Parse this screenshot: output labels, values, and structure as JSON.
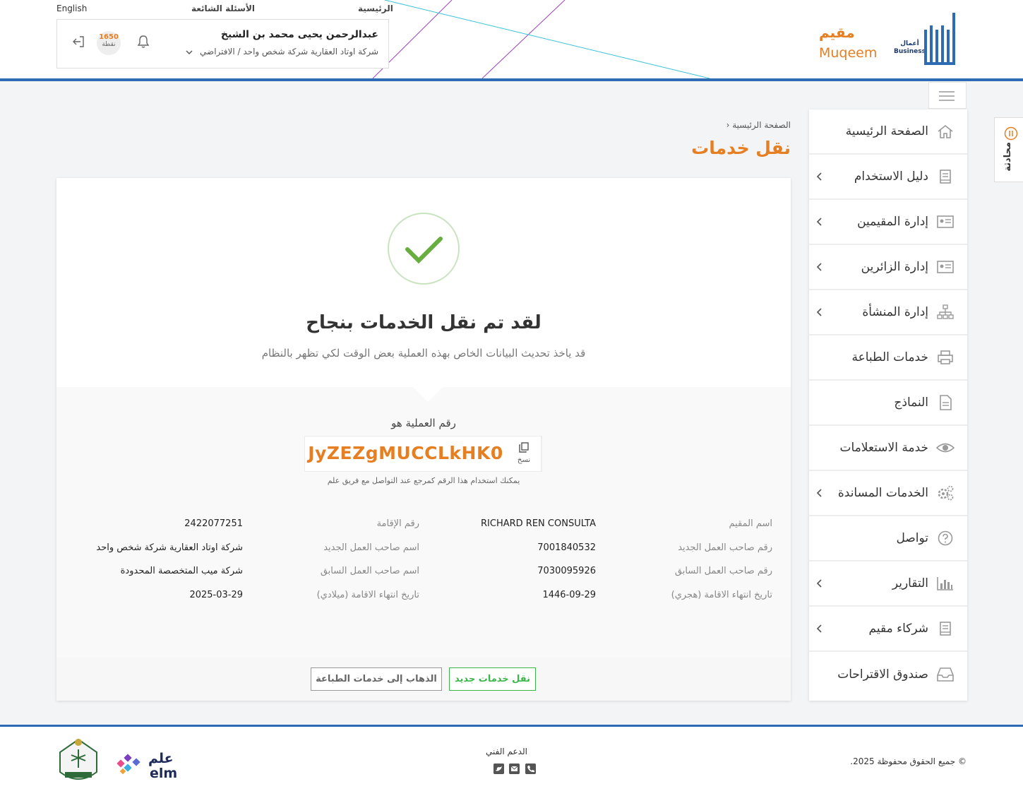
{
  "topnav": {
    "home": "الرئيسية",
    "faq": "الأسئلة الشائعة",
    "language": "English"
  },
  "user": {
    "name": "عبدالرحمن يحيى محمد بن الشيخ",
    "org": "شركة اوتاد العقارية شركة شخص واحد / الافتراضي",
    "points_value": "1650",
    "points_label": "نقطة"
  },
  "brand": {
    "muqeem_ar": "مقيم",
    "muqeem_en": "Muqeem",
    "absher_business_ar": "أعمال",
    "absher_business_en": "Business",
    "accent": "#e67e22",
    "primary": "#2d6cb5"
  },
  "sidebar": {
    "items": [
      {
        "label": "الصفحة الرئيسية",
        "icon": "home-icon",
        "chevron": false
      },
      {
        "label": "دليل الاستخدام",
        "icon": "book-icon",
        "chevron": true
      },
      {
        "label": "إدارة المقيمين",
        "icon": "id-card-icon",
        "chevron": true
      },
      {
        "label": "إدارة الزائرين",
        "icon": "id-card-icon",
        "chevron": true
      },
      {
        "label": "إدارة المنشأة",
        "icon": "org-chart-icon",
        "chevron": true
      },
      {
        "label": "خدمات الطباعة",
        "icon": "printer-icon",
        "chevron": false
      },
      {
        "label": "النماذج",
        "icon": "document-icon",
        "chevron": false
      },
      {
        "label": "خدمة الاستعلامات",
        "icon": "eye-icon",
        "chevron": false
      },
      {
        "label": "الخدمات المساندة",
        "icon": "gears-icon",
        "chevron": true
      },
      {
        "label": "تواصل",
        "icon": "help-icon",
        "chevron": false
      },
      {
        "label": "التقارير",
        "icon": "bar-chart-icon",
        "chevron": true
      },
      {
        "label": "شركاء مقيم",
        "icon": "book-icon",
        "chevron": true
      },
      {
        "label": "صندوق الاقتراحات",
        "icon": "inbox-icon",
        "chevron": false
      }
    ]
  },
  "chat": {
    "label": "محادثة"
  },
  "page": {
    "breadcrumb": "الصفحة الرئيسية",
    "title": "نقل خدمات"
  },
  "result": {
    "title": "لقد تم نقل الخدمات بنجاح",
    "subtitle": "قد ياخذ تحديث البيانات الخاص بهذه العملية بعض الوقت لكي تظهر بالنظام",
    "txn_label": "رقم العملية هو",
    "txn_code": "JyZEZgMUCCLkHK0",
    "copy_label": "نسخ",
    "txn_note": "يمكنك استخدام هذا الرقم كمرجع عند التواصل مع فريق علم"
  },
  "details": {
    "resident_name_label": "اسم المقيم",
    "resident_name": "RICHARD REN CONSULTA",
    "iqama_no_label": "رقم الإقامة",
    "iqama_no": "2422077251",
    "new_employer_no_label": "رقم صاحب العمل الجديد",
    "new_employer_no": "7001840532",
    "new_employer_name_label": "اسم صاحب العمل الجديد",
    "new_employer_name": "شركة اوتاد العقارية شركة شخص واحد",
    "prev_employer_no_label": "رقم صاحب العمل السابق",
    "prev_employer_no": "7030095926",
    "prev_employer_name_label": "اسم صاحب العمل السابق",
    "prev_employer_name": "شركة ميب المتخصصة المحدودة",
    "expiry_hijri_label": "تاريخ انتهاء الاقامة (هجري)",
    "expiry_hijri": "1446-09-29",
    "expiry_greg_label": "تاريخ انتهاء الاقامة (ميلادي)",
    "expiry_greg": "2025-03-29"
  },
  "actions": {
    "new_transfer": "نقل خدمات جديد",
    "go_print": "الذهاب إلى خدمات الطباعة"
  },
  "footer": {
    "copyright": "© جميع الحقوق محفوظة 2025.",
    "support": "الدعم الفني",
    "elm_ar": "علم",
    "elm_en": "elm"
  }
}
